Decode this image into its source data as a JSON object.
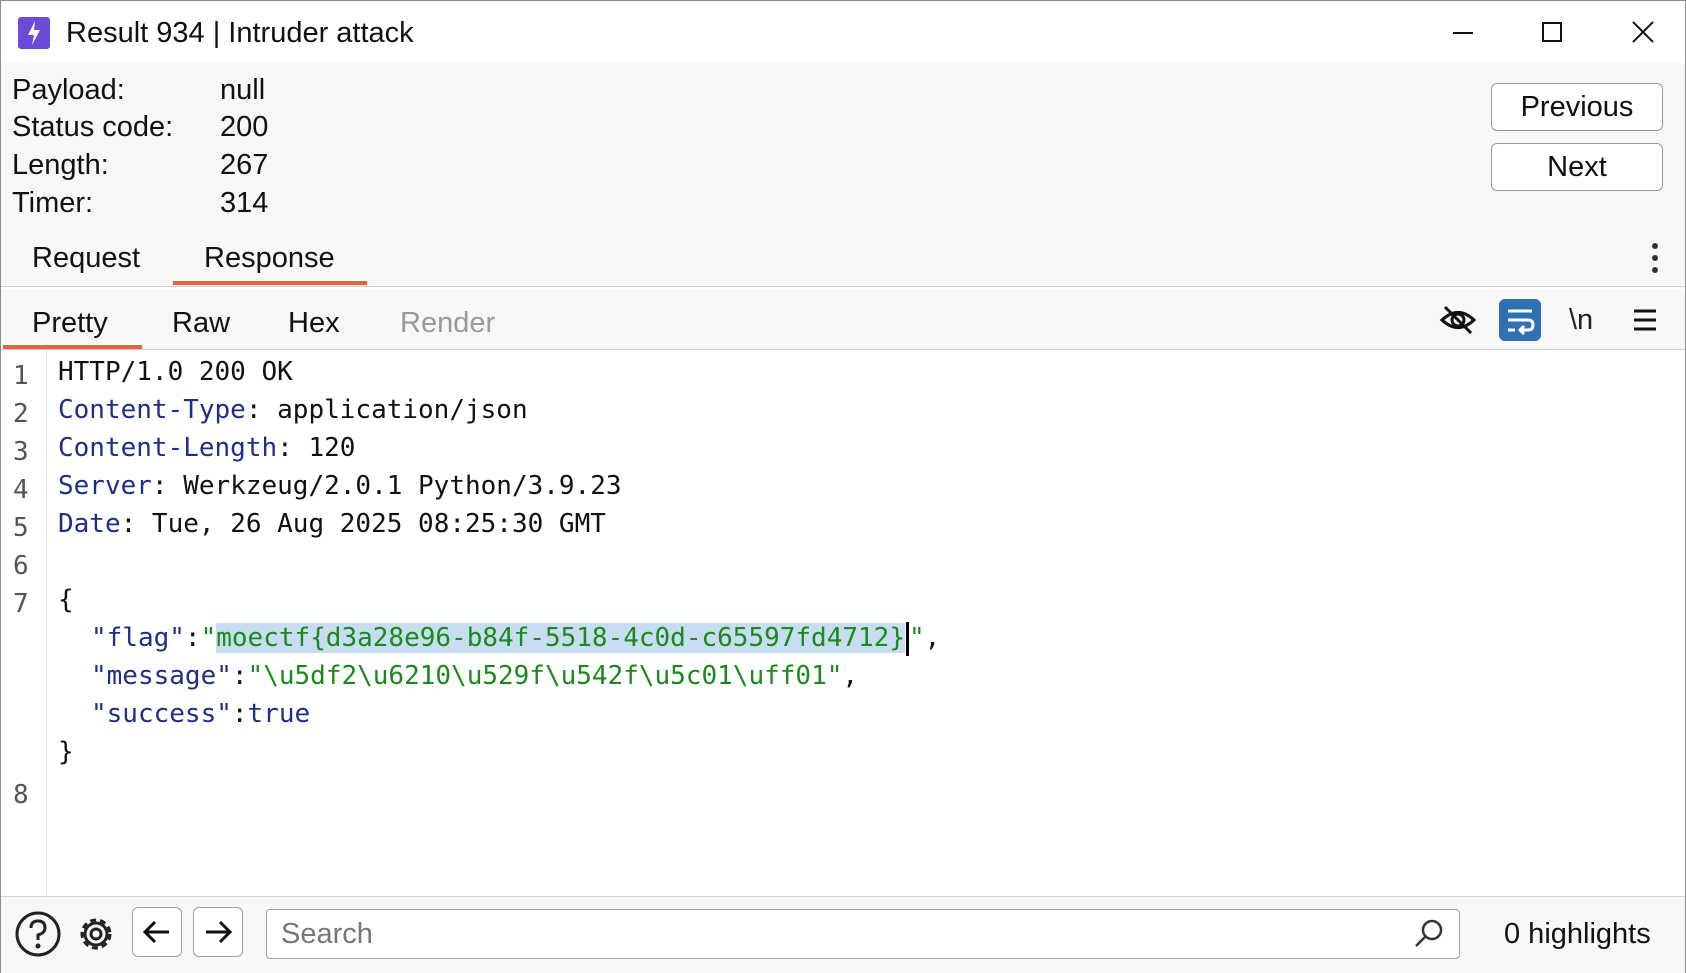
{
  "window": {
    "title": "Result 934 | Intruder attack"
  },
  "info": {
    "payload_label": "Payload:",
    "payload_value": "null",
    "status_label": "Status code:",
    "status_value": "200",
    "length_label": "Length:",
    "length_value": "267",
    "timer_label": "Timer:",
    "timer_value": "314"
  },
  "nav": {
    "previous": "Previous",
    "next": "Next"
  },
  "tabs": {
    "request": "Request",
    "response": "Response",
    "active": "Response"
  },
  "subtabs": {
    "pretty": "Pretty",
    "raw": "Raw",
    "hex": "Hex",
    "render": "Render",
    "active": "Pretty"
  },
  "toolbar": {
    "newline_label": "\\n",
    "icons": [
      "hide-eye-icon",
      "wrap-lines-icon",
      "newline-icon",
      "menu-icon"
    ]
  },
  "editor": {
    "line_numbers": [
      "1",
      "2",
      "3",
      "4",
      "5",
      "6",
      "7",
      "8"
    ],
    "status_line": "HTTP/1.0 200 OK",
    "headers": [
      {
        "name": "Content-Type",
        "value": ": application/json"
      },
      {
        "name": "Content-Length",
        "value": ": 120"
      },
      {
        "name": "Server",
        "value": ": Werkzeug/2.0.1 Python/3.9.23"
      },
      {
        "name": "Date",
        "value": ": Tue, 26 Aug 2025 08:25:30 GMT"
      }
    ],
    "json_open": "{",
    "json_close": "}",
    "flag_key": "\"flag\"",
    "flag_value": "moectf{d3a28e96-b84f-5518-4c0d-c65597fd4712}",
    "message_key": "\"message\"",
    "message_value": "\"\\u5df2\\u6210\\u529f\\u542f\\u5c01\\uff01\"",
    "success_key": "\"success\"",
    "success_value": "true"
  },
  "bottom": {
    "search_placeholder": "Search",
    "highlights": "0 highlights"
  },
  "colors": {
    "accent": "#e8603c",
    "app_icon": "#6d4ad8",
    "wrap_button": "#2f6fb3",
    "header_key": "#1d2f87",
    "json_string": "#1a8a1a",
    "selection": "#c8dcf2"
  }
}
